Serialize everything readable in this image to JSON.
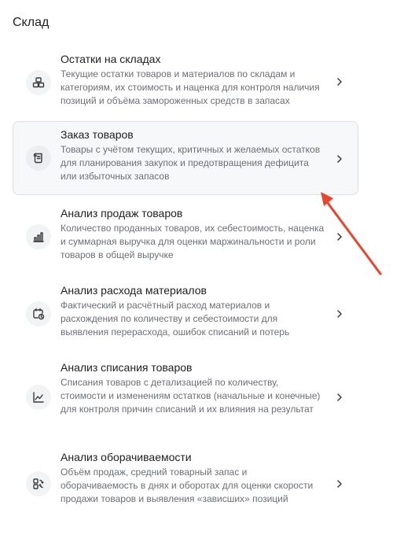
{
  "section": {
    "title": "Склад"
  },
  "items": [
    {
      "title": "Остатки на складах",
      "description": "Текущие остатки товаров и материалов по складам и категориям, их стоимость и наценка для контроля наличия позиций и объёма замороженных средств в запасах",
      "icon": "boxes-icon"
    },
    {
      "title": "Заказ товаров",
      "description": "Товары с учётом текущих, критичных и желаемых остатков для планирования закупок и предотвращения дефицита или избыточных запасов",
      "icon": "scroll-icon",
      "selected": true
    },
    {
      "title": "Анализ продаж товаров",
      "description": "Количество проданных товаров, их себестоимость, наценка и суммарная выручка для оценки маржинальности и роли товаров в общей выручке",
      "icon": "bar-chart-icon"
    },
    {
      "title": "Анализ расхода материалов",
      "description": "Фактический и расчётный расход материалов и расхождения по количеству и себестоимости для выявления перерасхода, ошибок списаний и потерь",
      "icon": "calendar-clock-icon"
    },
    {
      "title": "Анализ списания товаров",
      "description": "Списания товаров с детализацией по количеству, стоимости и изменениям остатков (начальные и конечные) для контроля причин списаний и их влияния на результат",
      "icon": "line-chart-icon"
    },
    {
      "title": "Анализ оборачиваемости",
      "description": "Объём продаж, средний товарный запас и оборачиваемость в днях и оборотах для оценки скорости продажи товаров и выявления «зависших» позиций",
      "icon": "turnover-icon"
    }
  ],
  "annotation": {
    "arrow_color": "#e8452c"
  }
}
